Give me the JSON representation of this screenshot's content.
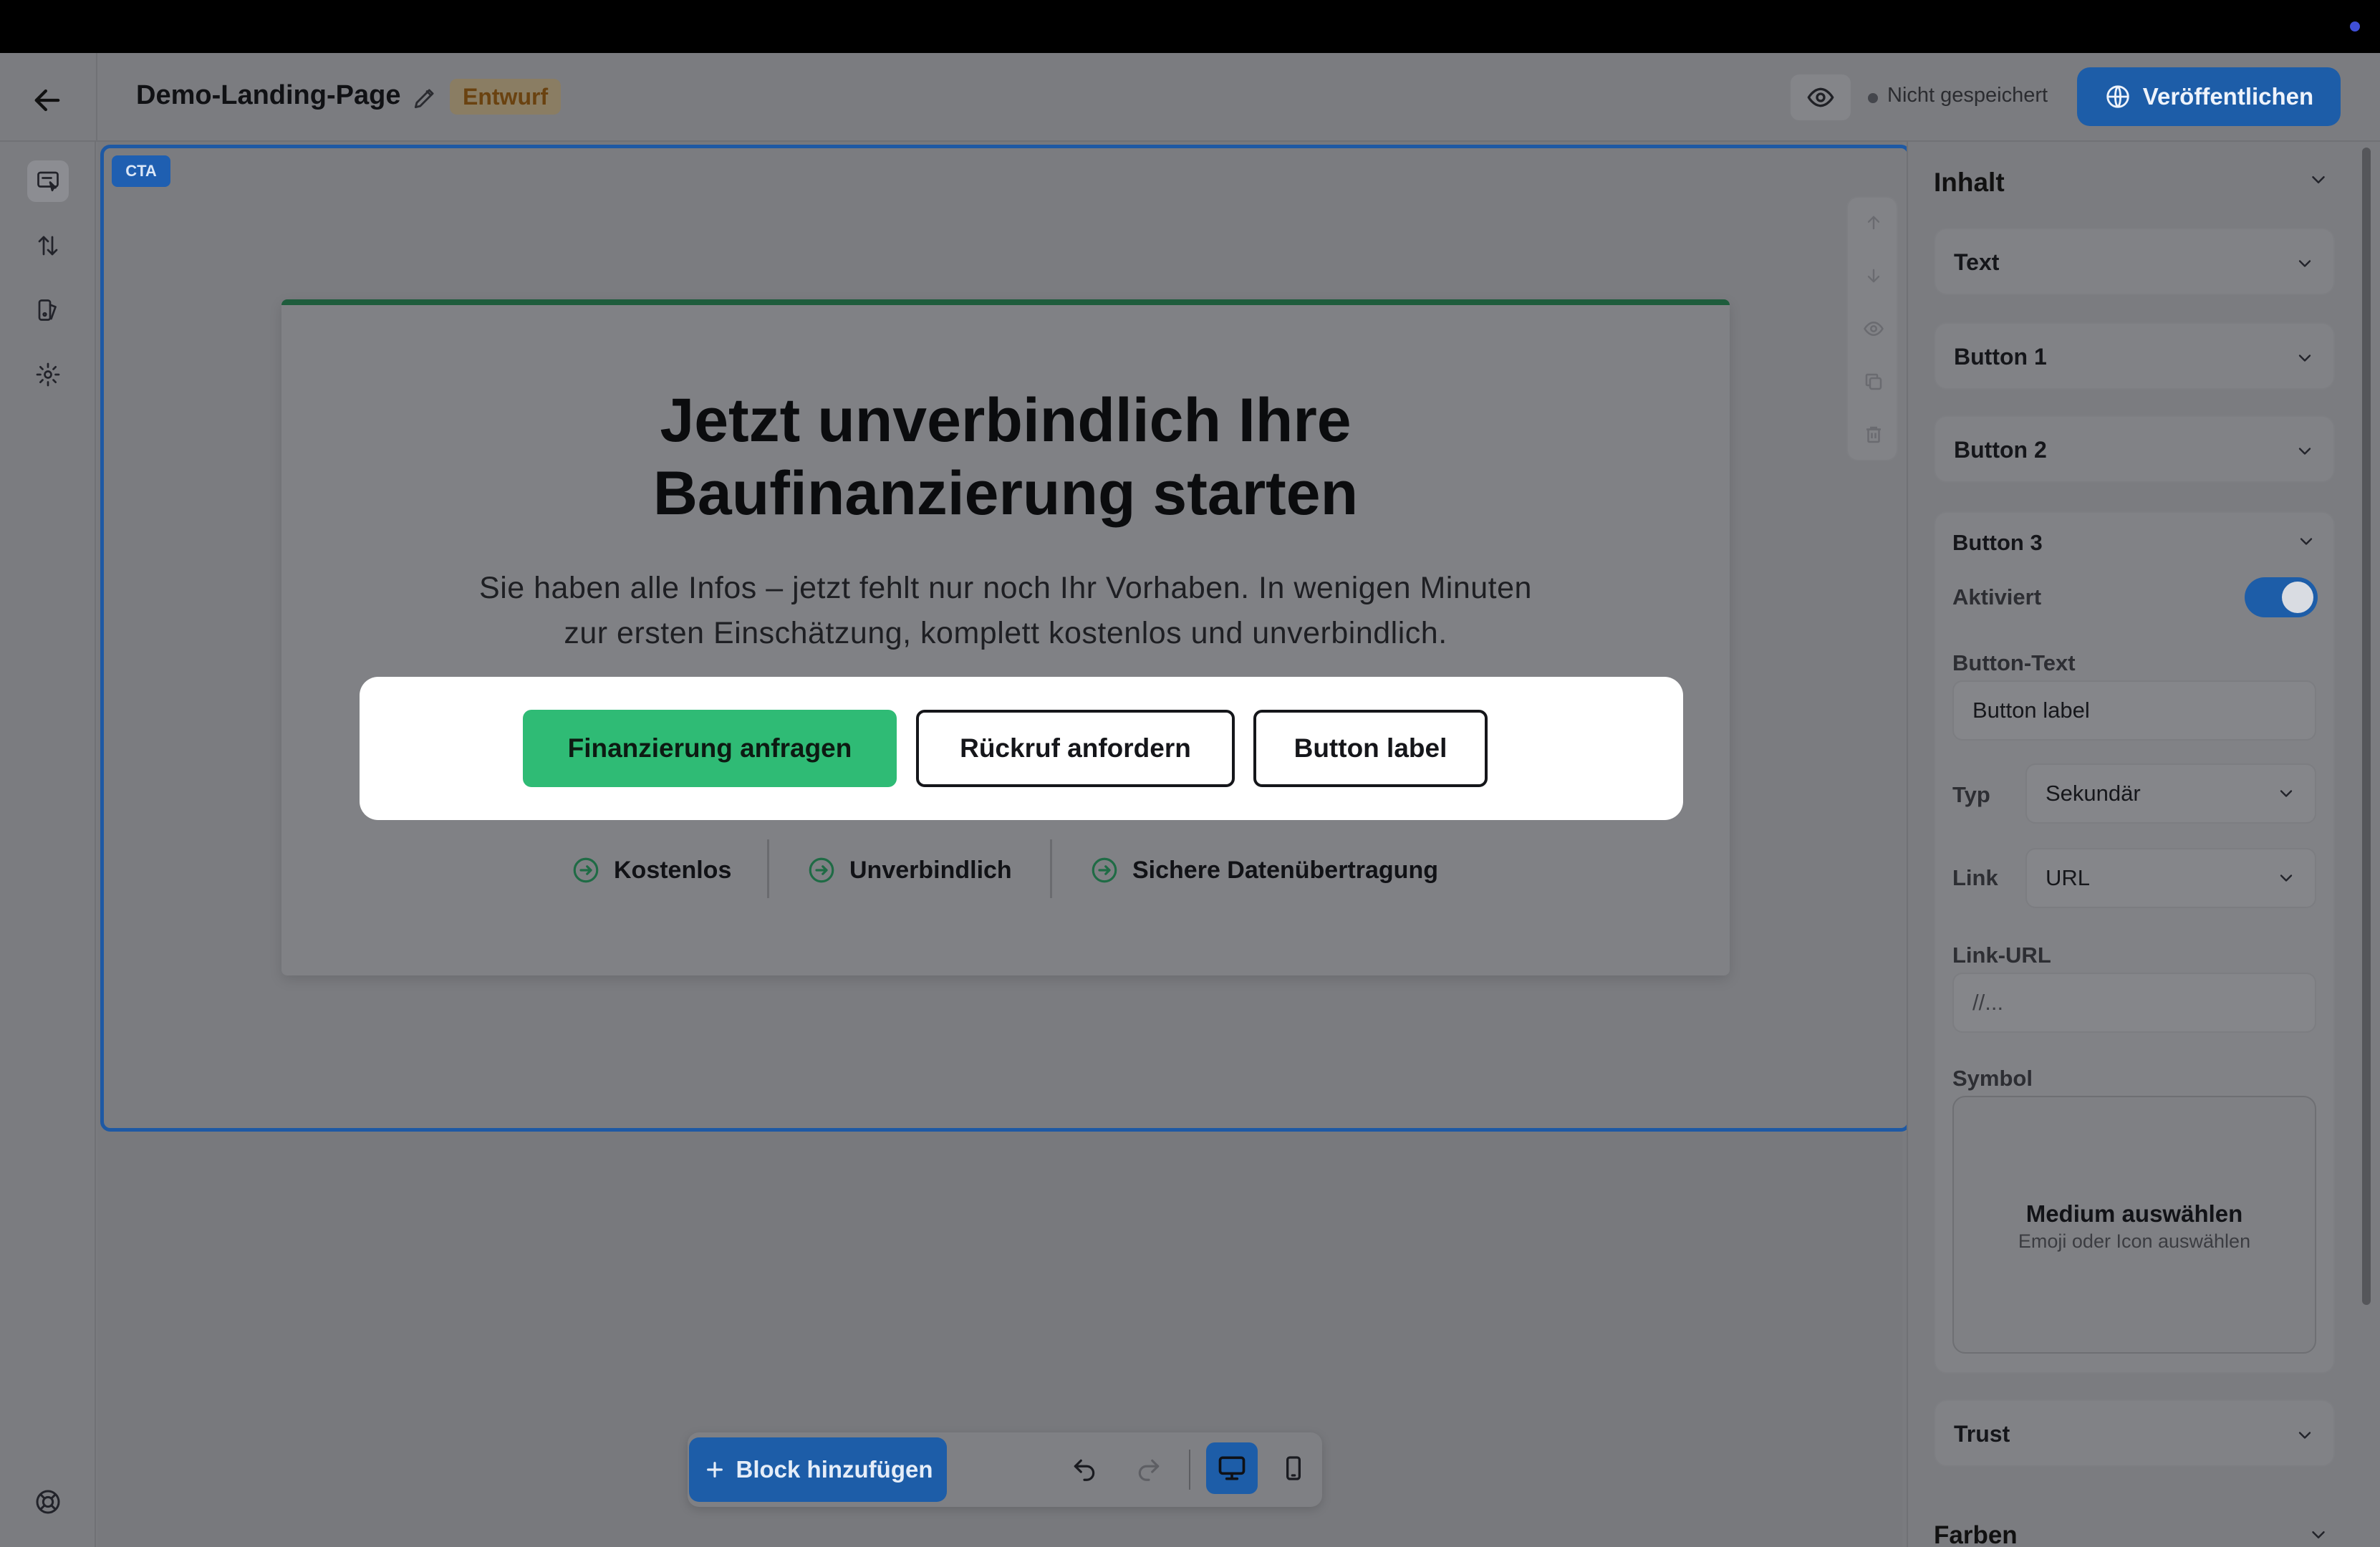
{
  "header": {
    "title": "Demo-Landing-Page",
    "badge": "Entwurf",
    "status": "Nicht gespeichert",
    "publish_label": "Veröffentlichen"
  },
  "canvas": {
    "block_tag": "CTA",
    "headline_line1": "Jetzt unverbindlich Ihre",
    "headline_line2": "Baufinanzierung starten",
    "subtext_line1": "Sie haben alle Infos – jetzt fehlt nur noch Ihr Vorhaben. In wenigen Minuten",
    "subtext_line2": "zur ersten Einschätzung, komplett kostenlos und unverbindlich.",
    "buttons": [
      {
        "label": "Finanzierung anfragen"
      },
      {
        "label": "Rückruf anfordern"
      },
      {
        "label": "Button label"
      }
    ],
    "trust": [
      {
        "label": "Kostenlos"
      },
      {
        "label": "Unverbindlich"
      },
      {
        "label": "Sichere Datenübertragung"
      }
    ],
    "colors": {
      "accent": "#2fbb75",
      "selection": "#1e59a4"
    }
  },
  "toolbar": {
    "add_block_label": "Block hinzufügen"
  },
  "panel": {
    "title": "Inhalt",
    "sections": [
      {
        "label": "Text"
      },
      {
        "label": "Button 1"
      },
      {
        "label": "Button 2"
      },
      {
        "label": "Button 3"
      },
      {
        "label": "Trust"
      },
      {
        "label": "Farben"
      }
    ],
    "button3": {
      "enabled_label": "Aktiviert",
      "enabled": true,
      "text_label": "Button-Text",
      "text_value": "Button label",
      "type_label": "Typ",
      "type_value": "Sekundär",
      "link_label": "Link",
      "link_value": "URL",
      "url_label": "Link-URL",
      "url_value": "//...",
      "symbol_label": "Symbol",
      "media_title": "Medium auswählen",
      "media_hint": "Emoji oder Icon auswählen"
    }
  }
}
